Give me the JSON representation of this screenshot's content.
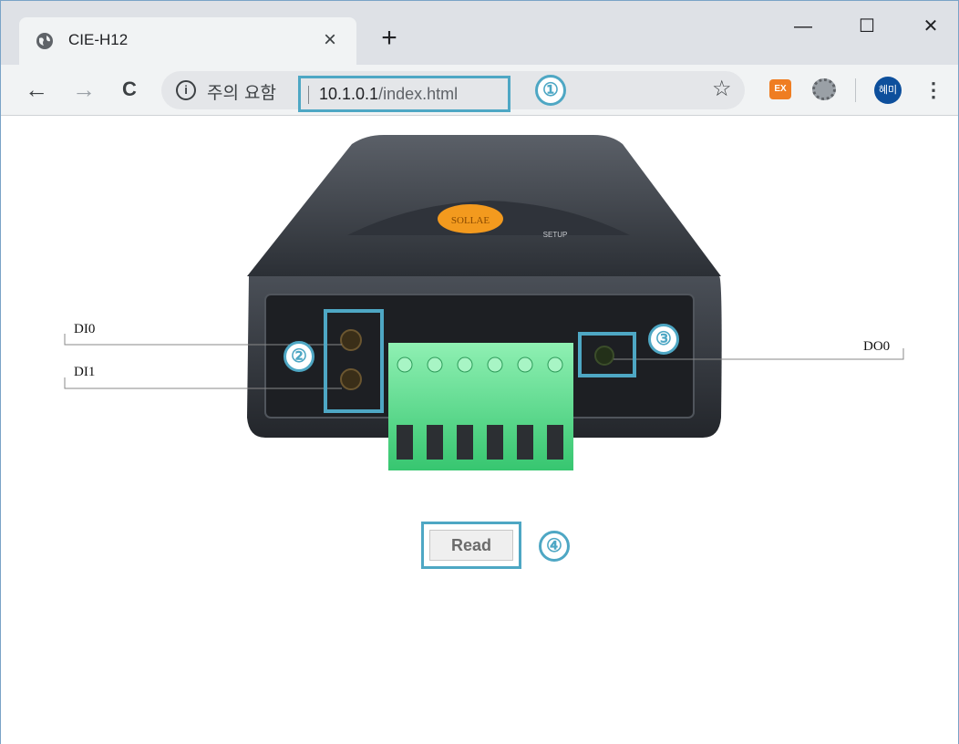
{
  "browser": {
    "tab_title": "CIE-H12",
    "tab_close": "×",
    "new_tab": "+",
    "window_minimize": "—",
    "window_maximize": "☐",
    "window_close": "✕",
    "security_label": "주의 요함",
    "url_host": "10.1.0.1",
    "url_path": "/index.html",
    "ext_ex_label": "EX",
    "avatar_label": "혜미",
    "info_glyph": "i",
    "menu_glyph": "⋮",
    "star_glyph": "☆",
    "back_glyph": "←",
    "forward_glyph": "→",
    "reload_glyph": "C",
    "icons": [
      "globe-icon",
      "back-arrow-icon",
      "forward-arrow-icon",
      "reload-icon",
      "info-icon",
      "star-icon",
      "ex-extension-icon",
      "gear-extension-icon",
      "avatar",
      "menu-icon"
    ]
  },
  "callouts": [
    "①",
    "②",
    "③",
    "④"
  ],
  "device": {
    "brand": "SOLLAE",
    "model_tag": "SETUP",
    "labels": {
      "di0": "DI0",
      "di1": "DI1",
      "do0": "DO0"
    },
    "colors": {
      "body": "#3a3e45",
      "terminal": "#4fe08a",
      "logo": "#f39a1e",
      "highlight": "#4ea7c4"
    }
  },
  "read_button": "Read"
}
